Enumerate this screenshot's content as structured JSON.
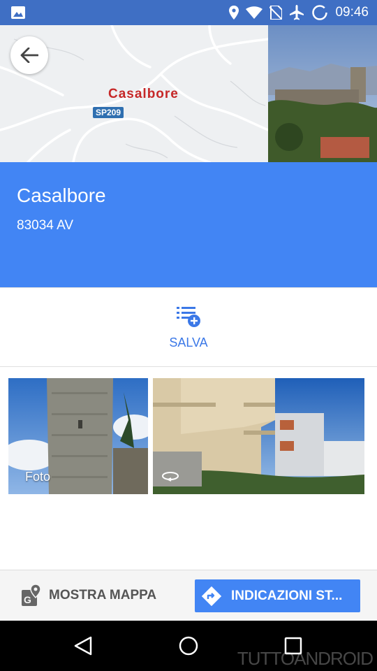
{
  "status_bar": {
    "time": "09:46",
    "icons": [
      "image-icon",
      "location-pin-icon",
      "wifi-icon",
      "no-sim-icon",
      "airplane-icon",
      "battery-icon"
    ]
  },
  "header": {
    "map_place_label": "Casalbore",
    "map_road_label": "SP209"
  },
  "place": {
    "title": "Casalbore",
    "address": "83034 AV",
    "accent_color": "#4285f4"
  },
  "actions": {
    "save_label": "SALVA"
  },
  "photos": {
    "caption": "Foto"
  },
  "bottom_bar": {
    "show_map_label": "MOSTRA MAPPA",
    "directions_label": "INDICAZIONI ST..."
  },
  "watermark": "TUTTOANDROID"
}
